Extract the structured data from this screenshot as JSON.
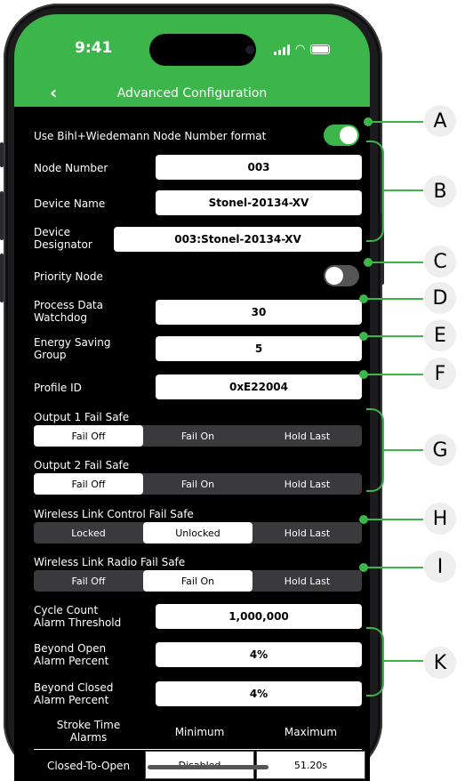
{
  "status": {
    "time": "9:41"
  },
  "nav": {
    "back_glyph": "‹",
    "title": "Advanced Configuration"
  },
  "rows": {
    "node_format": {
      "label": "Use Bihl+Wiedemann Node Number format",
      "on": true
    },
    "node_number": {
      "label": "Node Number",
      "value": "003"
    },
    "device_name": {
      "label": "Device Name",
      "value": "Stonel-20134-XV"
    },
    "device_designator": {
      "label1": "Device",
      "label2": "Designator",
      "value": "003:Stonel-20134-XV"
    },
    "priority_node": {
      "label": "Priority Node",
      "on": false
    },
    "watchdog": {
      "label1": "Process Data",
      "label2": "Watchdog",
      "value": "30"
    },
    "energy_group": {
      "label1": "Energy Saving",
      "label2": "Group",
      "value": "5"
    },
    "profile_id": {
      "label": "Profile ID",
      "value": "0xE22004"
    },
    "output1": {
      "label": "Output 1 Fail Safe",
      "options": [
        "Fail Off",
        "Fail On",
        "Hold Last"
      ],
      "selected": 0
    },
    "output2": {
      "label": "Output 2 Fail Safe",
      "options": [
        "Fail Off",
        "Fail On",
        "Hold Last"
      ],
      "selected": 0
    },
    "wl_control": {
      "label": "Wireless Link Control Fail Safe",
      "options": [
        "Locked",
        "Unlocked",
        "Hold Last"
      ],
      "selected": 1
    },
    "wl_radio": {
      "label": "Wireless Link Radio Fail Safe",
      "options": [
        "Fail Off",
        "Fail On",
        "Hold Last"
      ],
      "selected": 1
    },
    "cycle_count": {
      "label1": "Cycle Count",
      "label2": "Alarm Threshold",
      "value": "1,000,000"
    },
    "beyond_open": {
      "label1": "Beyond Open",
      "label2": "Alarm Percent",
      "value": "4%"
    },
    "beyond_closed": {
      "label1": "Beyond Closed",
      "label2": "Alarm Percent",
      "value": "4%"
    }
  },
  "stroke": {
    "head1": "Stroke Time",
    "head2": "Alarms",
    "min": "Minimum",
    "max": "Maximum",
    "row_label": "Closed-To-Open",
    "row_min": "Disabled",
    "row_max": "51.20s"
  },
  "callouts": [
    "A",
    "B",
    "C",
    "D",
    "E",
    "F",
    "G",
    "H",
    "I",
    "K"
  ],
  "colors": {
    "accent": "#3cb64a"
  }
}
